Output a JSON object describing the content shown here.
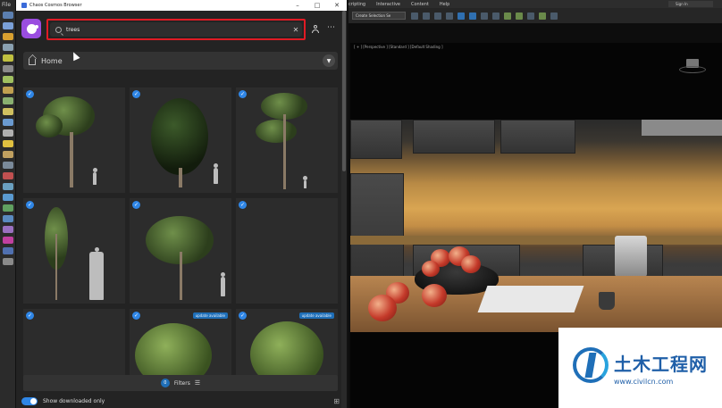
{
  "browser": {
    "title": "Chaos Cosmos Browser",
    "search": {
      "value": "trees"
    },
    "home_label": "Home",
    "filters_count": "0",
    "filters_label": "Filters",
    "show_downloaded_label": "Show downloaded only",
    "cards": [
      {
        "checked": true,
        "badge": ""
      },
      {
        "checked": true,
        "badge": ""
      },
      {
        "checked": true,
        "badge": ""
      },
      {
        "checked": true,
        "badge": ""
      },
      {
        "checked": true,
        "badge": ""
      },
      {
        "checked": true,
        "badge": ""
      },
      {
        "checked": true,
        "badge": ""
      },
      {
        "checked": true,
        "badge": "update available"
      },
      {
        "checked": true,
        "badge": "update available"
      }
    ],
    "accent": "#2f86e6",
    "highlight_border": "#e01b24"
  },
  "max": {
    "menu_file": "File",
    "menu": [
      "cripting",
      "Interactive",
      "Content",
      "Help"
    ],
    "sign_in": "Sign In",
    "selection_set": "Create Selection Se",
    "viewport_label": "[ + ] [Perspective ] [Standard ] [Default Shading ]"
  },
  "watermark": {
    "title": "土木工程网",
    "url": "www.civilcn.com"
  }
}
